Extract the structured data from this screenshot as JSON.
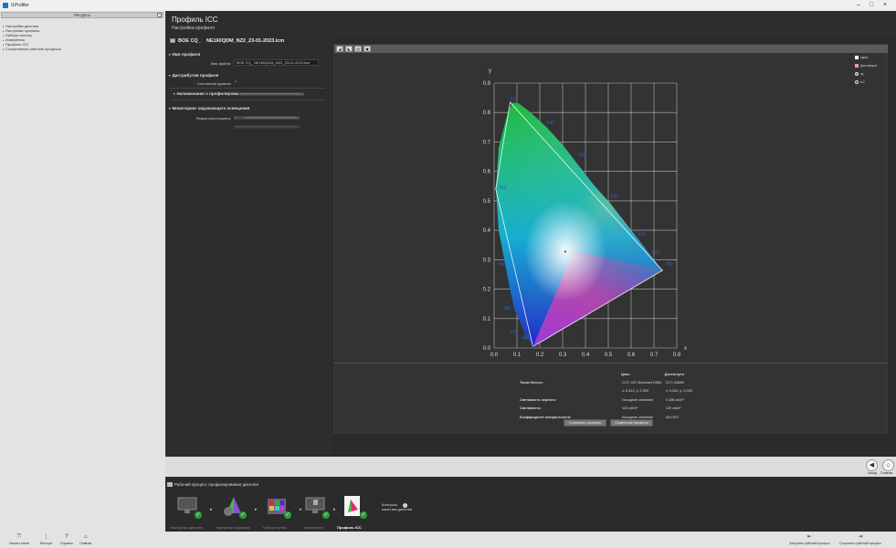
{
  "window": {
    "title": "i1Profiler",
    "controls": [
      "–",
      "□",
      "×"
    ]
  },
  "sidebar": {
    "header": "Ресурсы",
    "items": [
      {
        "label": "Настройки дисплея"
      },
      {
        "label": "Настройки профиля"
      },
      {
        "label": "Наборы пленок"
      },
      {
        "label": "Измерения"
      },
      {
        "label": "Профиль ICC"
      },
      {
        "label": "Сохраненные рабочие процессы"
      }
    ]
  },
  "header": {
    "title": "Профиль ICC",
    "subtitle": "Настройка профиля"
  },
  "profile_name": {
    "prefix": "BOE CQ_",
    "name": "NE160QDM_NZ2_23-01-2023.icm"
  },
  "sections": {
    "profile_name": {
      "title": "Имя профиля",
      "file_label": "Имя файла:",
      "file_value": "BOE CQ_     NE160QDM_NZ2_23-01-2023.icm"
    },
    "distribution": {
      "title": "Дистрибутив профиля",
      "system_level_label": "Системный уровень",
      "check": "✓",
      "profiling_reminder_label": "Напоминание о профилировании",
      "profiling_reminder_value": ""
    },
    "ambient": {
      "title": "Мониторинг окружающего освещения",
      "mode_label": "Режим мониторинга:",
      "mode_value": "Выкл."
    }
  },
  "chart_toolbar": {
    "buttons": [
      "◢",
      "◣",
      "▤",
      "▣"
    ]
  },
  "chart_legend": {
    "items": [
      {
        "label": "Цель",
        "color": "#ffffff"
      },
      {
        "label": "Достигнуто",
        "color": "#e8a0a0"
      }
    ],
    "radios": [
      {
        "label": "xy",
        "selected": true
      },
      {
        "label": "u'v'",
        "selected": false
      }
    ]
  },
  "chart_data": {
    "type": "scatter",
    "title": "",
    "xlabel": "x",
    "ylabel": "y",
    "xlim": [
      0,
      0.8
    ],
    "ylim": [
      0,
      0.9
    ],
    "xticks": [
      "0.0",
      "0.1",
      "0.2",
      "0.3",
      "0.4",
      "0.5",
      "0.6",
      "0.7",
      "0.8"
    ],
    "yticks": [
      "0.0",
      "0.1",
      "0.2",
      "0.3",
      "0.4",
      "0.5",
      "0.6",
      "0.7",
      "0.8",
      "0.9"
    ],
    "gamut": [
      {
        "x": 0.74,
        "y": 0.265
      },
      {
        "x": 0.17,
        "y": 0.005
      },
      {
        "x": 0.007,
        "y": 0.54
      },
      {
        "x": 0.07,
        "y": 0.835
      },
      {
        "x": 0.735,
        "y": 0.265
      }
    ],
    "white_point": {
      "x": 0.312,
      "y": 0.329
    },
    "wavelength_labels": [
      {
        "label": "520",
        "x": 0.07,
        "y": 0.84
      },
      {
        "label": "540",
        "x": 0.23,
        "y": 0.76
      },
      {
        "label": "560",
        "x": 0.37,
        "y": 0.65
      },
      {
        "label": "580",
        "x": 0.51,
        "y": 0.51
      },
      {
        "label": "600",
        "x": 0.63,
        "y": 0.38
      },
      {
        "label": "620",
        "x": 0.69,
        "y": 0.32
      },
      {
        "label": "700",
        "x": 0.75,
        "y": 0.28
      },
      {
        "label": "500",
        "x": 0.02,
        "y": 0.54
      },
      {
        "label": "490",
        "x": 0.02,
        "y": 0.28
      },
      {
        "label": "480",
        "x": 0.04,
        "y": 0.13
      },
      {
        "label": "470",
        "x": 0.07,
        "y": 0.05
      },
      {
        "label": "460",
        "x": 0.12,
        "y": 0.03
      },
      {
        "label": "380",
        "x": 0.16,
        "y": 0.0
      }
    ]
  },
  "stats": {
    "col_target": "Цель",
    "col_achieved": "Достигнуто",
    "rows": [
      {
        "key": "Точка белого:",
        "target": "CCT: CIE Illuminant D65K",
        "achieved": "CCT: 6486K"
      },
      {
        "key": "",
        "target": "x: 0.312, y: 0.329",
        "achieved": "x: 0.312, y: 0.330"
      },
      {
        "key": "Светимость черного:",
        "target": "Исходное значение",
        "achieved": "0.336 cd/m²"
      },
      {
        "key": "Светимость:",
        "target": "120 cd/m²",
        "achieved": "120 cd/m²"
      },
      {
        "key": "Коэффициент контрастности:",
        "target": "Исходное значение",
        "achieved": "324.39∶1"
      }
    ]
  },
  "buttons": {
    "save": "Сохранить профиль",
    "compare": "Сравнение профиля"
  },
  "nav": {
    "back": "Назад",
    "home": "Главная"
  },
  "workflow": {
    "title": "Рабочий процесс профилирования дисплея",
    "steps": [
      {
        "label": "Настройки дисплея",
        "active": false
      },
      {
        "label": "Настройки профиля",
        "active": false
      },
      {
        "label": "Набор пленок",
        "active": false
      },
      {
        "label": "Измерение",
        "active": false
      },
      {
        "label": "Профиль ICC",
        "active": true
      }
    ],
    "extra": "Контроль\nкачества дисплея"
  },
  "statusbar": {
    "left": [
      {
        "label": "Начало меню",
        "icon": "⤧"
      },
      {
        "label": "Вектора",
        "icon": "⋮"
      },
      {
        "label": "Справка",
        "icon": "?"
      },
      {
        "label": "Главная",
        "icon": "⌂"
      }
    ],
    "right": [
      {
        "label": "Загрузить рабочий процесс",
        "icon": "⇤"
      },
      {
        "label": "Сохранить рабочий процесс",
        "icon": "⇥"
      }
    ]
  }
}
